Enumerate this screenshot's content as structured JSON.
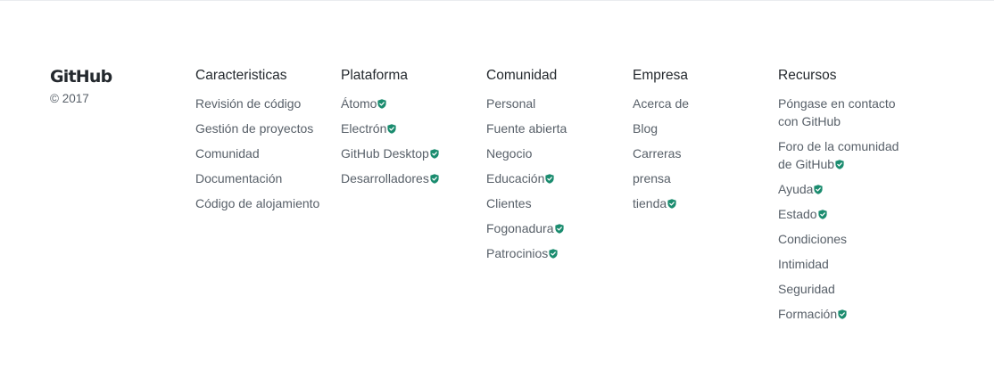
{
  "brand": {
    "logo_text": "GitHub",
    "copyright": "© 2017"
  },
  "accent_color": "#1b8c6f",
  "verified_icon": "shield-check-icon",
  "columns": [
    {
      "title": "Caracteristicas",
      "items": [
        {
          "label": "Revisión de código",
          "verified": false
        },
        {
          "label": "Gestión de proyectos",
          "verified": false
        },
        {
          "label": "Comunidad",
          "verified": false
        },
        {
          "label": "Documentación",
          "verified": false
        },
        {
          "label": "Código de alojamiento",
          "verified": false
        }
      ]
    },
    {
      "title": "Plataforma",
      "items": [
        {
          "label": "Átomo",
          "verified": true
        },
        {
          "label": "Electrón",
          "verified": true
        },
        {
          "label": "GitHub Desktop",
          "verified": true
        },
        {
          "label": "Desarrolladores",
          "verified": true
        }
      ]
    },
    {
      "title": "Comunidad",
      "items": [
        {
          "label": "Personal",
          "verified": false
        },
        {
          "label": "Fuente abierta",
          "verified": false
        },
        {
          "label": "Negocio",
          "verified": false
        },
        {
          "label": "Educación",
          "verified": true
        },
        {
          "label": "Clientes",
          "verified": false
        },
        {
          "label": "Fogonadura",
          "verified": true
        },
        {
          "label": "Patrocinios",
          "verified": true
        }
      ]
    },
    {
      "title": "Empresa",
      "items": [
        {
          "label": "Acerca de",
          "verified": false
        },
        {
          "label": "Blog",
          "verified": false
        },
        {
          "label": "Carreras",
          "verified": false
        },
        {
          "label": "prensa",
          "verified": false
        },
        {
          "label": "tienda",
          "verified": true
        }
      ]
    },
    {
      "title": "Recursos",
      "items": [
        {
          "label": "Póngase en contacto con GitHub",
          "verified": false
        },
        {
          "label": "Foro de la comunidad de GitHub",
          "verified": true
        },
        {
          "label": "Ayuda",
          "verified": true
        },
        {
          "label": "Estado",
          "verified": true
        },
        {
          "label": "Condiciones",
          "verified": false
        },
        {
          "label": "Intimidad",
          "verified": false
        },
        {
          "label": "Seguridad",
          "verified": false
        },
        {
          "label": "Formación",
          "verified": true
        }
      ]
    }
  ]
}
